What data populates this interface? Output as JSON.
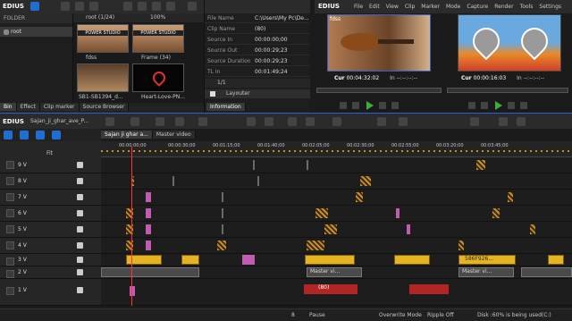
{
  "app": {
    "name": "EDIUS"
  },
  "bin": {
    "folder_header": "FOLDER",
    "root_folder": "root",
    "path_label": "root (1/24)",
    "zoom": "100%",
    "items": [
      {
        "label": "fdss"
      },
      {
        "label": "Frame (34)"
      },
      {
        "label": "SB1-SB1394_d..."
      },
      {
        "label": "Heart-Love-PN..."
      }
    ],
    "tabs": [
      "Bin",
      "Effect",
      "Clip marker",
      "Source Browser"
    ]
  },
  "info": {
    "rows": [
      {
        "k": "File Name",
        "v": "C:\\Users\\My Pc\\De..."
      },
      {
        "k": "Clip Name",
        "v": "(80)"
      },
      {
        "k": "Source In",
        "v": "00:00:00;00"
      },
      {
        "k": "Source Out",
        "v": "00:00:29;23"
      },
      {
        "k": "Source Duration",
        "v": "00:00:29;23"
      },
      {
        "k": "TL In",
        "v": "00:01:49;24"
      }
    ],
    "page": "1/1",
    "layouter": "Layouter",
    "tab": "Information"
  },
  "player": {
    "logo": "EDIUS",
    "menu": [
      "File",
      "Edit",
      "View",
      "Clip",
      "Marker",
      "Mode",
      "Capture",
      "Render",
      "Tools",
      "Settings"
    ],
    "source_label": "fdss",
    "source_cur": "00:04:32:02",
    "program_cur": "00:00:16:03",
    "cur_label": "Cur",
    "in_label": "In",
    "in_value": "--:--:--:--"
  },
  "timeline": {
    "logo": "EDIUS",
    "project": "Sajan_ji_ghar_ave_P...",
    "seq_tabs": [
      "Sajan ji ghar a...",
      "Master video"
    ],
    "ruler": [
      "00:00:00;00",
      "00:00:30;00",
      "00:01:15;00",
      "00:01:40;00",
      "00:02:05;00",
      "00:02:30;00",
      "00:02:55;00",
      "00:03:20;00",
      "00:03:45;00"
    ],
    "fit": "Fit",
    "tracks": [
      {
        "name": "9 V"
      },
      {
        "name": "8 V"
      },
      {
        "name": "7 V"
      },
      {
        "name": "6 V"
      },
      {
        "name": "5 V"
      },
      {
        "name": "4 V"
      },
      {
        "name": "3 V"
      },
      {
        "name": "2 V"
      },
      {
        "name": "1 V"
      }
    ],
    "clips": {
      "yellow_mid": "(80)",
      "yellow_right": "586F926...",
      "master_1": "Master vi...",
      "master_2": "Master vi...",
      "red_1": "(80)"
    }
  },
  "status": {
    "count": "8",
    "pause": "Pause",
    "overwrite": "Overwrite Mode",
    "ripple": "Ripple Off",
    "disk": "Disk :60% is being used(C:)"
  },
  "colors": {
    "accent": "#1f6fd0",
    "playhead": "#ff3333",
    "hatch": "#c98d2a",
    "pink": "#c25bb2"
  }
}
